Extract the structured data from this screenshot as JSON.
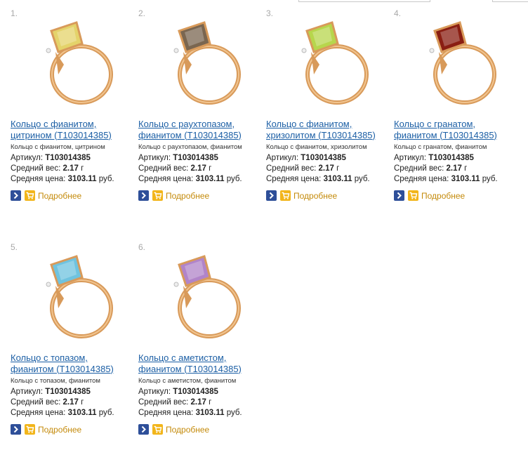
{
  "products": [
    {
      "index": "1.",
      "title_line1": "Кольцо с фианитом,",
      "title_line2": "цитрином (Т103014385)",
      "description": "Кольцо с фианитом, цитрином",
      "sku_label": "Артикул:",
      "sku": "Т103014385",
      "weight_label": "Средний вес:",
      "weight": "2.17",
      "weight_unit": "г",
      "price_label": "Средняя цена:",
      "price": "3103.11",
      "price_unit": "руб.",
      "more_label": "Подробнее",
      "stone_color": "#e4d36a"
    },
    {
      "index": "2.",
      "title_line1": "Кольцо с раухтопазом,",
      "title_line2": "фианитом (Т103014385)",
      "description": "Кольцо с раухтопазом, фианитом",
      "sku_label": "Артикул:",
      "sku": "Т103014385",
      "weight_label": "Средний вес:",
      "weight": "2.17",
      "weight_unit": "г",
      "price_label": "Средняя цена:",
      "price": "3103.11",
      "price_unit": "руб.",
      "more_label": "Подробнее",
      "stone_color": "#7a6650"
    },
    {
      "index": "3.",
      "title_line1": "Кольцо с фианитом,",
      "title_line2": "хризолитом (Т103014385)",
      "description": "Кольцо с фианитом, хризолитом",
      "sku_label": "Артикул:",
      "sku": "Т103014385",
      "weight_label": "Средний вес:",
      "weight": "2.17",
      "weight_unit": "г",
      "price_label": "Средняя цена:",
      "price": "3103.11",
      "price_unit": "руб.",
      "more_label": "Подробнее",
      "stone_color": "#b7d64c"
    },
    {
      "index": "4.",
      "title_line1": "Кольцо с гранатом,",
      "title_line2": "фианитом (Т103014385)",
      "description": "Кольцо с гранатом, фианитом",
      "sku_label": "Артикул:",
      "sku": "Т103014385",
      "weight_label": "Средний вес:",
      "weight": "2.17",
      "weight_unit": "г",
      "price_label": "Средняя цена:",
      "price": "3103.11",
      "price_unit": "руб.",
      "more_label": "Подробнее",
      "stone_color": "#8a1e12"
    },
    {
      "index": "5.",
      "title_line1": "Кольцо с топазом,",
      "title_line2": "фианитом (Т103014385)",
      "description": "Кольцо с топазом, фианитом",
      "sku_label": "Артикул:",
      "sku": "Т103014385",
      "weight_label": "Средний вес:",
      "weight": "2.17",
      "weight_unit": "г",
      "price_label": "Средняя цена:",
      "price": "3103.11",
      "price_unit": "руб.",
      "more_label": "Подробнее",
      "stone_color": "#6fc3df"
    },
    {
      "index": "6.",
      "title_line1": "Кольцо с аметистом,",
      "title_line2": "фианитом (Т103014385)",
      "description": "Кольцо с аметистом, фианитом",
      "sku_label": "Артикул:",
      "sku": "Т103014385",
      "weight_label": "Средний вес:",
      "weight": "2.17",
      "weight_unit": "г",
      "price_label": "Средняя цена:",
      "price": "3103.11",
      "price_unit": "руб.",
      "more_label": "Подробнее",
      "stone_color": "#b184c9"
    }
  ],
  "icons": {
    "arrow_button": "chevron-right-icon",
    "cart_button": "cart-icon"
  },
  "colors": {
    "link": "#1c5fa5",
    "more_link": "#c48a0a",
    "arrow_button_bg": "#2e4f99",
    "cart_button_bg": "#f2b51a",
    "gold": "#d89a5a"
  }
}
